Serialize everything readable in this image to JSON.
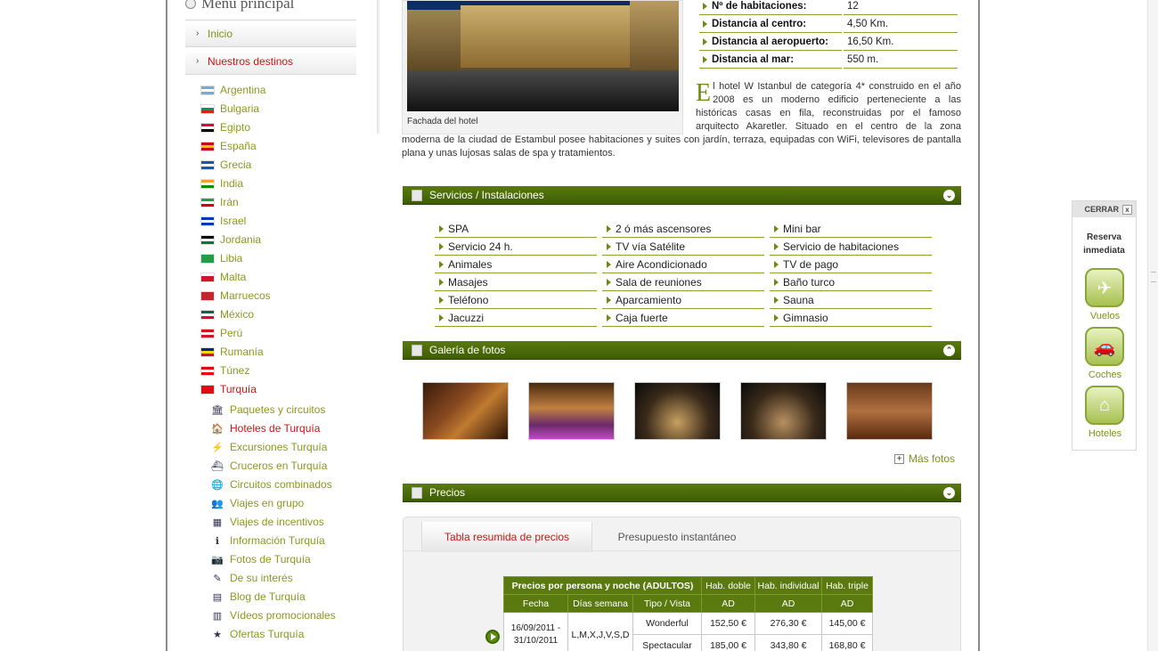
{
  "menu": {
    "title": "Menú principal",
    "items": [
      {
        "label": "Inicio"
      },
      {
        "label": "Nuestros destinos"
      }
    ]
  },
  "countries": [
    {
      "label": "Argentina",
      "flag": [
        "#75aadb",
        "#ffffff",
        "#75aadb"
      ]
    },
    {
      "label": "Bulgaria",
      "flag": [
        "#ffffff",
        "#00966e",
        "#d62612"
      ]
    },
    {
      "label": "Egipto",
      "flag": [
        "#ce1126",
        "#ffffff",
        "#000000"
      ]
    },
    {
      "label": "España",
      "flag": [
        "#c60b1e",
        "#ffc400",
        "#c60b1e"
      ]
    },
    {
      "label": "Grecia",
      "flag": [
        "#0d5eaf",
        "#ffffff",
        "#0d5eaf"
      ]
    },
    {
      "label": "India",
      "flag": [
        "#ff9933",
        "#ffffff",
        "#138808"
      ]
    },
    {
      "label": "Irán",
      "flag": [
        "#239f40",
        "#ffffff",
        "#da0000"
      ]
    },
    {
      "label": "Israel",
      "flag": [
        "#0038b8",
        "#ffffff",
        "#0038b8"
      ]
    },
    {
      "label": "Jordania",
      "flag": [
        "#000000",
        "#ffffff",
        "#007a3d"
      ]
    },
    {
      "label": "Libia",
      "flag": [
        "#239e46",
        "#239e46",
        "#239e46"
      ]
    },
    {
      "label": "Malta",
      "flag": [
        "#ffffff",
        "#cf142b",
        "#cf142b"
      ]
    },
    {
      "label": "Marruecos",
      "flag": [
        "#c1272d",
        "#c1272d",
        "#c1272d"
      ]
    },
    {
      "label": "México",
      "flag": [
        "#006847",
        "#ffffff",
        "#ce1126"
      ]
    },
    {
      "label": "Perú",
      "flag": [
        "#d91023",
        "#ffffff",
        "#d91023"
      ]
    },
    {
      "label": "Rumanía",
      "flag": [
        "#002b7f",
        "#fcd116",
        "#ce1126"
      ]
    },
    {
      "label": "Túnez",
      "flag": [
        "#e70013",
        "#ffffff",
        "#e70013"
      ]
    },
    {
      "label": "Turquía",
      "flag": [
        "#e30a17",
        "#e30a17",
        "#e30a17"
      ]
    }
  ],
  "turquia_sub": [
    {
      "label": "Paquetes y circuitos",
      "icon": "monument-icon",
      "glyph": "🏛"
    },
    {
      "label": "Hoteles de Turquía",
      "icon": "hotel-icon",
      "glyph": "🏠"
    },
    {
      "label": "Excursiones Turquía",
      "icon": "excursion-icon",
      "glyph": "⚡"
    },
    {
      "label": "Cruceros en Turquía",
      "icon": "cruise-icon",
      "glyph": "⛴"
    },
    {
      "label": "Circuitos combinados",
      "icon": "globe-icon",
      "glyph": "🌐"
    },
    {
      "label": "Viajes en grupo",
      "icon": "group-icon",
      "glyph": "👥"
    },
    {
      "label": "Viajes de incentivos",
      "icon": "incentive-icon",
      "glyph": "▦"
    },
    {
      "label": "Información Turquía",
      "icon": "info-icon",
      "glyph": "ℹ"
    },
    {
      "label": "Fotos de Turquía",
      "icon": "camera-icon",
      "glyph": "📷"
    },
    {
      "label": "De su interés",
      "icon": "interest-icon",
      "glyph": "✎"
    },
    {
      "label": "Blog de Turquía",
      "icon": "blog-icon",
      "glyph": "▤"
    },
    {
      "label": "Vídeos promocionales",
      "icon": "film-icon",
      "glyph": "▥"
    },
    {
      "label": "Ofertas Turquía",
      "icon": "star-icon",
      "glyph": "★"
    }
  ],
  "photo_caption": "Fachada del hotel",
  "hotel_info": [
    {
      "label": "Nº de habitaciones:",
      "value": "12"
    },
    {
      "label": "Distancia al centro:",
      "value": "4,50 Km."
    },
    {
      "label": "Distancia al aeropuerto:",
      "value": "16,50 Km."
    },
    {
      "label": "Distancia al mar:",
      "value": "550 m."
    }
  ],
  "description": {
    "dropcap": "E",
    "text": "l hotel W Istanbul de categoría 4* construido en el año 2008 es un moderno edificio perteneciente a las históricas casas en fila,  reconstruidas por el famoso arquitecto Akaretler. Situado en el centro de la zona moderna de la ciudad de Estambul posee habitaciones y suites con jardín, terraza, equipadas con WiFi, televisores de pantalla plana y unas lujosas salas de spa y tratamientos."
  },
  "sections": {
    "services": "Servicios / Instalaciones",
    "gallery": "Galería de fotos",
    "prices": "Precios"
  },
  "services": [
    [
      "SPA",
      "2 ó más ascensores",
      "Mini bar"
    ],
    [
      "Servicio 24 h.",
      "TV vía Satélite",
      "Servicio de habitaciones"
    ],
    [
      "Animales",
      "Aire Acondicionado",
      "TV de pago"
    ],
    [
      "Masajes",
      "Sala de reuniones",
      "Baño turco"
    ],
    [
      "Teléfono",
      "Aparcamiento",
      "Sauna"
    ],
    [
      "Jacuzzi",
      "Caja fuerte",
      "Gimnasio"
    ]
  ],
  "gallery_more": "Más fotos",
  "price_tabs": [
    "Tabla resumida de precios",
    "Presupuesto instantáneo"
  ],
  "price_table": {
    "header1": [
      "Precios por persona y noche (ADULTOS)",
      "Hab. doble",
      "Hab. individual",
      "Hab. triple"
    ],
    "header2": [
      "Fecha",
      "Días semana",
      "Tipo / Vista",
      "AD",
      "AD",
      "AD"
    ],
    "date_range": "16/09/2011 - 31/10/2011",
    "days": "L,M,X,J,V,S,D",
    "rows": [
      {
        "tipo": "Wonderful",
        "doble": "152,50 €",
        "individual": "276,30 €",
        "triple": "145,00 €"
      },
      {
        "tipo": "Spectacular",
        "doble": "185,00 €",
        "individual": "343,80 €",
        "triple": "168,80 €"
      }
    ]
  },
  "widget": {
    "close": "CERRAR",
    "close_x": "x",
    "title": "Reserva inmediata",
    "buttons": [
      {
        "label": "Vuelos",
        "icon": "airplane-icon",
        "glyph": "✈"
      },
      {
        "label": "Coches",
        "icon": "car-icon",
        "glyph": "🚗"
      },
      {
        "label": "Hoteles",
        "icon": "house-icon",
        "glyph": "⌂"
      }
    ]
  }
}
